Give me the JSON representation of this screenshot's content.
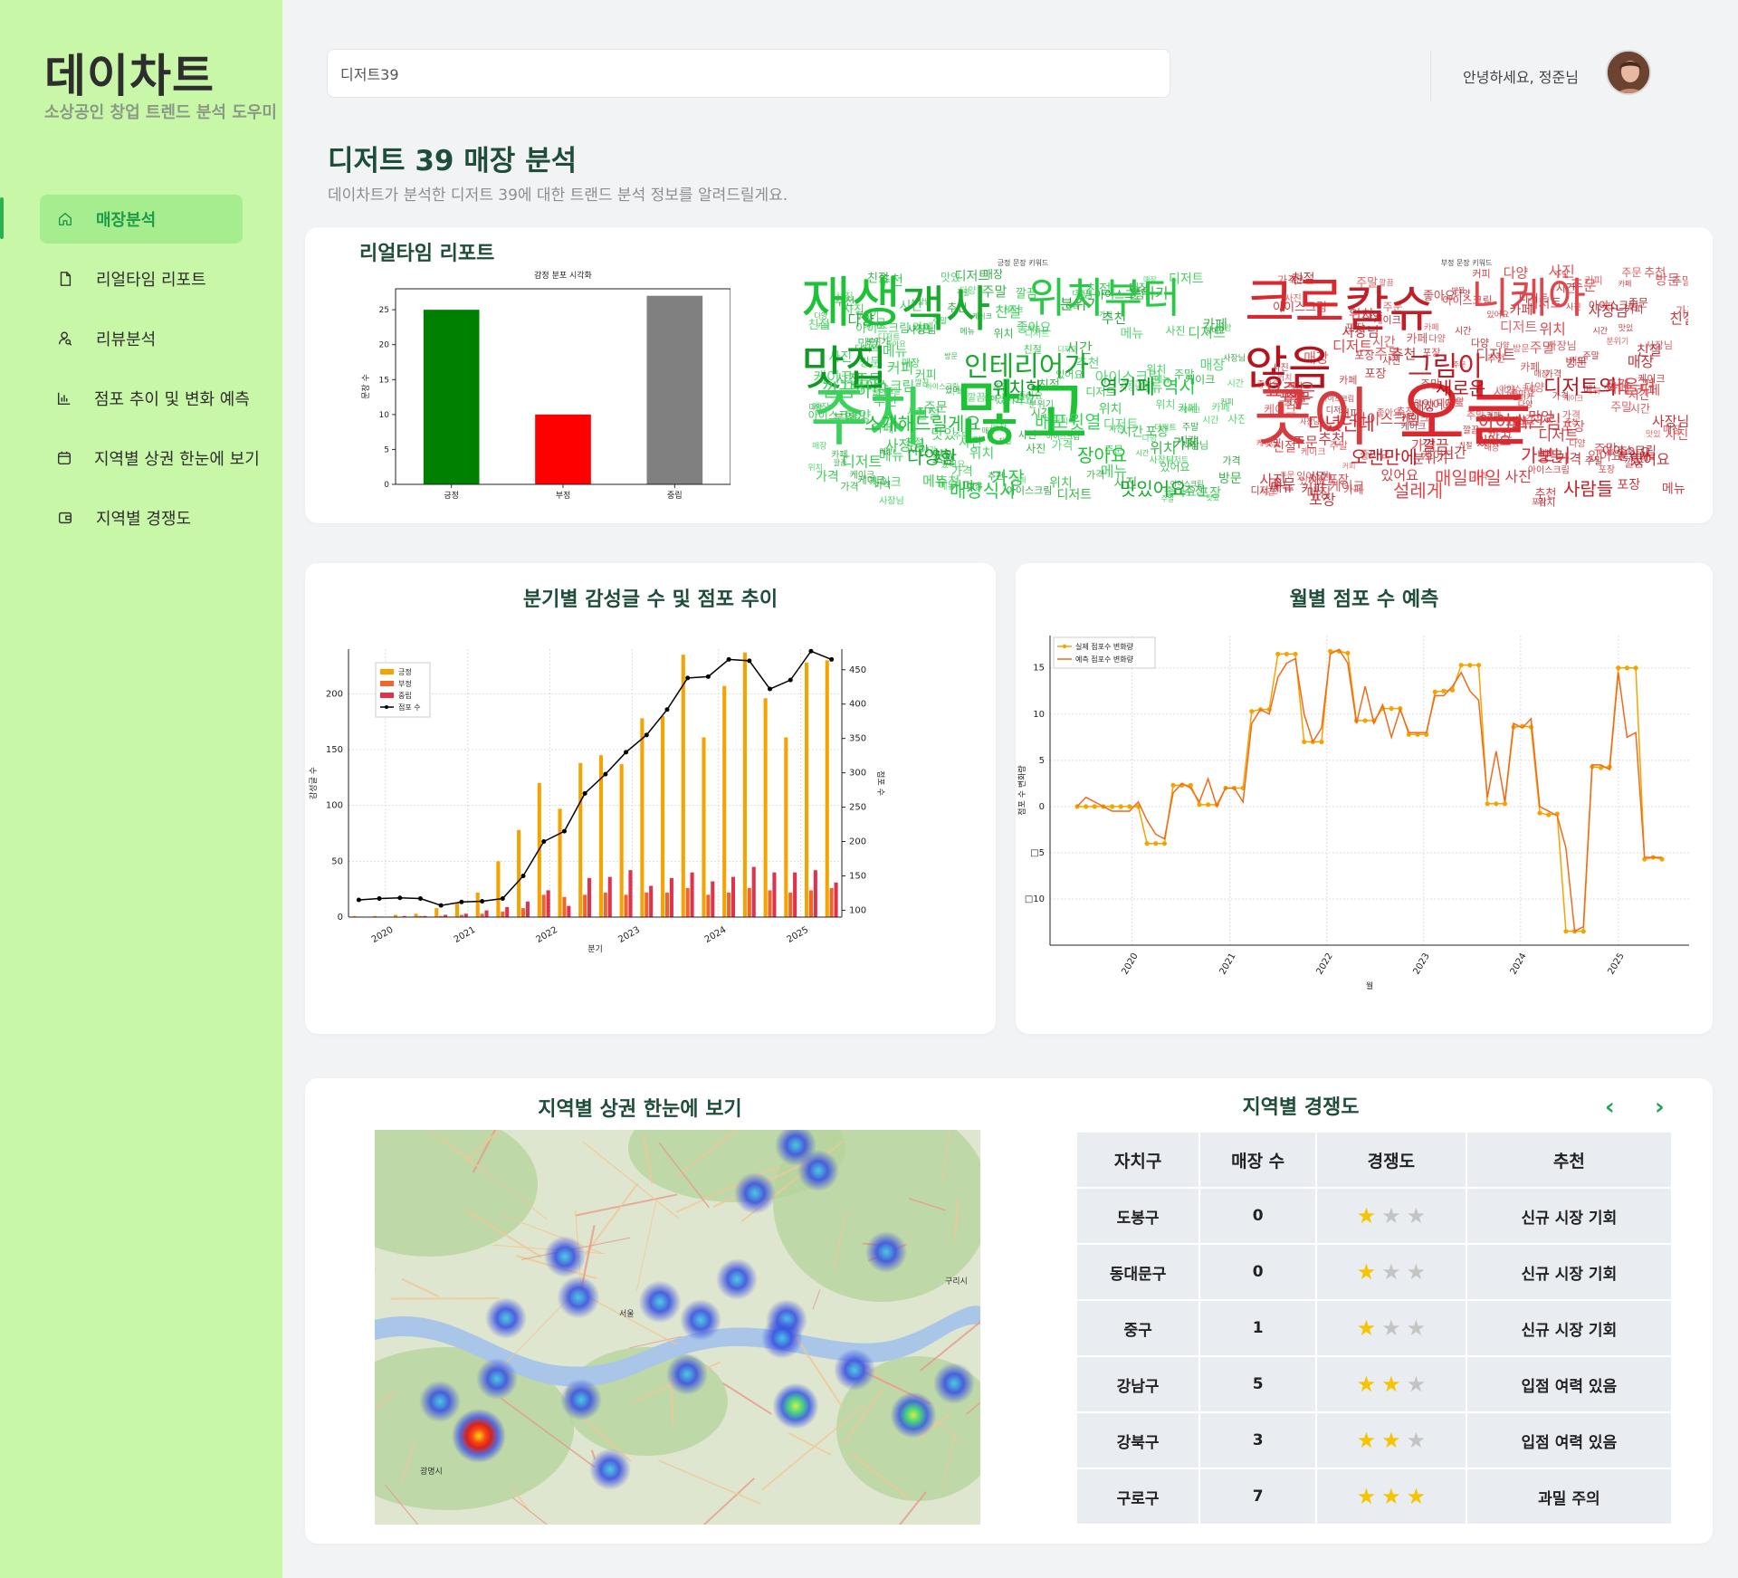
{
  "app": {
    "title": "데이차트",
    "subtitle": "소상공인 창업 트렌드 분석 도우미"
  },
  "sidebar": {
    "items": [
      {
        "label": "매장분석",
        "icon": "home-icon",
        "active": true
      },
      {
        "label": "리얼타임 리포트",
        "icon": "document-icon",
        "active": false
      },
      {
        "label": "리뷰분석",
        "icon": "user-search-icon",
        "active": false
      },
      {
        "label": "점포 추이 및 변화 예측",
        "icon": "bar-chart-icon",
        "active": false
      },
      {
        "label": "지역별 상권 한눈에 보기",
        "icon": "calendar-icon",
        "active": false
      },
      {
        "label": "지역별 경쟁도",
        "icon": "wallet-icon",
        "active": false
      }
    ]
  },
  "header": {
    "search_value": "디저트39",
    "greeting": "안녕하세요, 정준님"
  },
  "page": {
    "title": "디저트 39 매장 분석",
    "description": "데이차트가 분석한 디저트 39에 대한 트랜드 분석 정보를 알려드릴게요."
  },
  "realtime": {
    "title": "리얼타임 리포트",
    "wordcloud_pos_title": "긍정 문장 키워드",
    "wordcloud_neg_title": "부정 문장 키워드",
    "wordcloud_pos_words": [
      "재생",
      "객사",
      "위치부터",
      "맛집",
      "주차",
      "많고",
      "인테리어가",
      "가장",
      "역키페",
      "깔끔하고",
      "소개해드릴게요",
      "다양한",
      "매장식사",
      "위치한",
      "배포윗열",
      "장아요",
      "맛있어요",
      "역시"
    ],
    "wordcloud_neg_words": [
      "크로",
      "칼슈",
      "니케아",
      "않음",
      "곳이",
      "오늘",
      "그림이",
      "매일매일",
      "디저트의",
      "요즘은",
      "다녔던데",
      "오랜만에",
      "설레게",
      "새로운",
      "아이스크림",
      "가보니",
      "사람들",
      "어울려"
    ]
  },
  "chart_data": [
    {
      "type": "bar",
      "title": "감정 분포 시각화",
      "xlabel": "",
      "ylabel": "문장 수",
      "categories": [
        "긍정",
        "부정",
        "중립"
      ],
      "values": [
        25,
        10,
        27
      ],
      "colors": [
        "#008000",
        "#ff0000",
        "#808080"
      ],
      "ylim": [
        0,
        28
      ],
      "yticks": [
        0,
        5,
        10,
        15,
        20,
        25
      ]
    },
    {
      "type": "bar",
      "title": "분기별 감성글 수 및 점포 추이",
      "xlabel": "분기",
      "ylabel": "감성글 수",
      "y2label": "점포 수",
      "x_ticks": [
        "2020",
        "2021",
        "2022",
        "2023",
        "2024",
        "2025"
      ],
      "ylim": [
        0,
        240
      ],
      "y2lim": [
        90,
        480
      ],
      "yticks": [
        0,
        50,
        100,
        150,
        200
      ],
      "y2ticks": [
        100,
        150,
        200,
        250,
        300,
        350,
        400,
        450
      ],
      "legend": "top-left",
      "categories": [
        "2019Q3",
        "2019Q4",
        "2020Q1",
        "2020Q2",
        "2020Q3",
        "2020Q4",
        "2021Q1",
        "2021Q2",
        "2021Q3",
        "2021Q4",
        "2022Q1",
        "2022Q2",
        "2022Q3",
        "2022Q4",
        "2023Q1",
        "2023Q2",
        "2023Q3",
        "2023Q4",
        "2024Q1",
        "2024Q2",
        "2024Q3",
        "2024Q4",
        "2025Q1",
        "2025Q2"
      ],
      "series": [
        {
          "name": "긍정",
          "color": "#f5a300",
          "values": [
            1,
            1,
            2,
            3,
            8,
            13,
            22,
            50,
            78,
            120,
            97,
            138,
            145,
            137,
            178,
            180,
            235,
            161,
            207,
            237,
            196,
            161,
            228,
            230
          ]
        },
        {
          "name": "부정",
          "color": "#f0652a",
          "values": [
            0,
            0,
            0,
            1,
            1,
            2,
            3,
            5,
            8,
            20,
            18,
            20,
            22,
            20,
            22,
            22,
            26,
            20,
            22,
            26,
            24,
            22,
            24,
            26
          ]
        },
        {
          "name": "중립",
          "color": "#e0324d",
          "values": [
            0,
            0,
            1,
            1,
            2,
            3,
            6,
            9,
            14,
            24,
            10,
            35,
            36,
            42,
            28,
            35,
            40,
            32,
            36,
            45,
            40,
            40,
            42,
            31
          ]
        },
        {
          "name": "점포 수",
          "color": "#000000",
          "type": "line",
          "values": [
            115,
            117,
            118,
            117,
            107,
            112,
            113,
            117,
            150,
            200,
            215,
            270,
            298,
            330,
            355,
            392,
            438,
            440,
            465,
            463,
            422,
            435,
            477,
            465
          ]
        }
      ]
    },
    {
      "type": "line",
      "title": "월별 점포 수 예측",
      "xlabel": "월",
      "ylabel": "점포 수 변화량",
      "x_ticks": [
        "2020",
        "2021",
        "2022",
        "2023",
        "2024",
        "2025"
      ],
      "yticks": [
        -10,
        -5,
        0,
        5,
        10,
        15
      ],
      "ytick_labels": [
        "□10",
        "□5",
        "0",
        "5",
        "10",
        "15"
      ],
      "ylim": [
        -15,
        18.5
      ],
      "legend": "top-left",
      "series": [
        {
          "name": "실제 점포수 변화량",
          "color": "#f5a300",
          "marker": true,
          "values": [
            0,
            0,
            0,
            0,
            0,
            0,
            0,
            0,
            -4,
            -4,
            -4,
            2.3,
            2.3,
            2.3,
            0.2,
            0.2,
            0.2,
            2,
            2,
            2,
            10.3,
            10.5,
            10.5,
            16.5,
            16.5,
            16.5,
            7,
            7,
            7,
            16.8,
            16.8,
            16.6,
            9.3,
            9.3,
            9.3,
            10.6,
            10.6,
            10.6,
            7.8,
            7.8,
            7.8,
            12.4,
            12.5,
            12.6,
            15.3,
            15.3,
            15.3,
            0.3,
            0.3,
            0.3,
            8.6,
            8.7,
            8.6,
            -0.7,
            -0.9,
            -0.8,
            -13.5,
            -13.5,
            -13.5,
            4.3,
            4.2,
            4.3,
            15,
            15,
            15,
            -5.7,
            -5.5,
            -5.7
          ]
        },
        {
          "name": "예측 점포수 변화량",
          "color": "#f06a1c",
          "marker": false,
          "values": [
            0,
            1,
            0.5,
            0,
            -0.5,
            -0.5,
            -0.5,
            0.5,
            -1.5,
            -3,
            -3.5,
            1.5,
            2.5,
            2,
            0.5,
            3,
            0,
            2,
            2,
            0.5,
            9,
            10.5,
            10,
            14,
            15.5,
            16,
            10,
            7,
            8.5,
            16.5,
            17,
            15.5,
            9,
            13,
            9,
            11,
            7.5,
            10.5,
            8,
            8,
            8,
            12,
            12,
            13,
            14.5,
            12.5,
            11.5,
            1,
            6,
            0.5,
            9,
            8.5,
            9.5,
            0,
            -0.5,
            -1,
            -4.5,
            -13.5,
            -13,
            4.5,
            4.5,
            4,
            14.5,
            7.5,
            8,
            -5.5,
            -5.5,
            -5.5
          ]
        }
      ]
    }
  ],
  "map": {
    "title": "지역별 상권 한눈에 보기",
    "labels": [
      "서울",
      "광명시",
      "구리시"
    ],
    "heat_points": [
      {
        "value": 0.3
      },
      {
        "value": 0.3
      },
      {
        "value": 0.3
      },
      {
        "value": 0.3
      },
      {
        "value": 0.35
      },
      {
        "value": 0.3
      },
      {
        "value": 0.3
      },
      {
        "value": 0.35
      },
      {
        "value": 0.3
      },
      {
        "value": 0.3
      },
      {
        "value": 0.3
      },
      {
        "value": 0.3
      },
      {
        "value": 0.3
      },
      {
        "value": 0.3
      },
      {
        "value": 0.3
      },
      {
        "value": 0.3
      },
      {
        "value": 0.3
      },
      {
        "value": 0.55
      },
      {
        "value": 1.0
      },
      {
        "value": 0.55
      },
      {
        "value": 0.3
      },
      {
        "value": 0.3
      }
    ]
  },
  "competition": {
    "title": "지역별 경쟁도",
    "prev_label": "‹",
    "next_label": "›",
    "headers": [
      "자치구",
      "매장 수",
      "경쟁도",
      "추천"
    ],
    "rows": [
      {
        "district": "도봉구",
        "stores": "0",
        "level": 1,
        "recommend": "신규 시장 기회"
      },
      {
        "district": "동대문구",
        "stores": "0",
        "level": 1,
        "recommend": "신규 시장 기회"
      },
      {
        "district": "중구",
        "stores": "1",
        "level": 1,
        "recommend": "신규 시장 기회"
      },
      {
        "district": "강남구",
        "stores": "5",
        "level": 2,
        "recommend": "입점 여력 있음"
      },
      {
        "district": "강북구",
        "stores": "3",
        "level": 2,
        "recommend": "입점 여력 있음"
      },
      {
        "district": "구로구",
        "stores": "7",
        "level": 3,
        "recommend": "과밀 주의"
      }
    ]
  },
  "colors": {
    "sidebar_bg": "#c8f7a8",
    "sidebar_active": "#a6ed8f",
    "accent": "#1f9a46",
    "heading": "#1e4d3a",
    "star_on": "#f6c400",
    "star_off": "#c4c4c4"
  }
}
